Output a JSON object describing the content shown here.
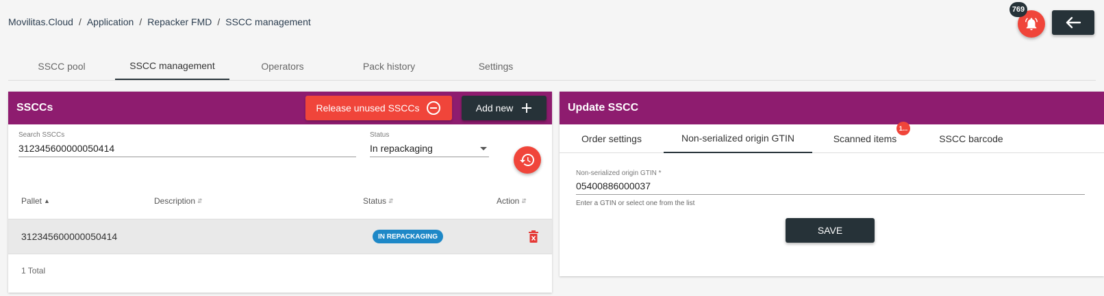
{
  "breadcrumb": [
    "Movilitas.Cloud",
    "Application",
    "Repacker FMD",
    "SSCC management"
  ],
  "breadcrumb_separator": "/",
  "notifications": {
    "count": "769"
  },
  "main_tabs": [
    {
      "label": "SSCC pool"
    },
    {
      "label": "SSCC management"
    },
    {
      "label": "Operators"
    },
    {
      "label": "Pack history"
    },
    {
      "label": "Settings"
    }
  ],
  "left_panel": {
    "title": "SSCCs",
    "release_button": "Release unused SSCCs",
    "add_button": "Add new",
    "search_label": "Search SSCCs",
    "search_value": "312345600000050414",
    "status_label": "Status",
    "status_value": "In repackaging",
    "columns": [
      "Pallet",
      "Description",
      "Status",
      "Action"
    ],
    "rows": [
      {
        "pallet": "312345600000050414",
        "description": "",
        "status": "IN REPACKAGING"
      }
    ],
    "total": "1 Total"
  },
  "right_panel": {
    "title": "Update SSCC",
    "tabs": [
      "Order settings",
      "Non-serialized origin GTIN",
      "Scanned items",
      "SSCC barcode"
    ],
    "scanned_badge": "1...",
    "gtin_label": "Non-serialized origin GTIN *",
    "gtin_value": "05400886000037",
    "gtin_hint": "Enter a GTIN or select one from the list",
    "save_button": "SAVE"
  },
  "colors": {
    "header": "#8e1c6f",
    "accent_red": "#f0453a",
    "dark": "#263238",
    "status_blue": "#1e88c7"
  }
}
